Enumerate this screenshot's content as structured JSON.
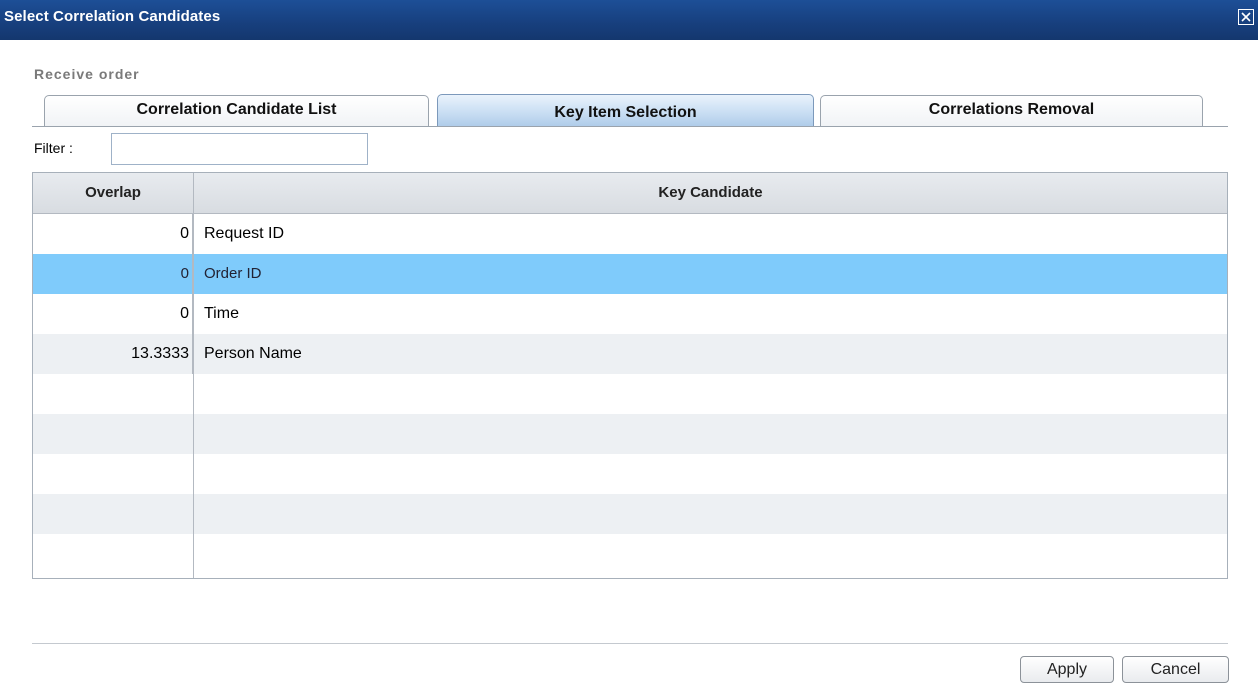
{
  "window": {
    "title": "Select Correlation Candidates"
  },
  "process_name": "Receive order",
  "tabs": [
    {
      "label": "Correlation Candidate List",
      "active": false
    },
    {
      "label": "Key Item Selection",
      "active": true
    },
    {
      "label": "Correlations Removal",
      "active": false
    }
  ],
  "filter": {
    "label": "Filter :",
    "value": "",
    "placeholder": ""
  },
  "grid": {
    "columns": {
      "overlap": "Overlap",
      "key_candidate": "Key Candidate"
    },
    "rows": [
      {
        "overlap": "0",
        "key": "Request ID",
        "selected": false
      },
      {
        "overlap": "0",
        "key": "Order ID",
        "selected": true
      },
      {
        "overlap": "0",
        "key": "Time",
        "selected": false
      },
      {
        "overlap": "13.3333",
        "key": "Person Name",
        "selected": false
      }
    ],
    "selected_color": "#7fcbfb"
  },
  "buttons": {
    "apply": "Apply",
    "cancel": "Cancel"
  },
  "colors": {
    "titlebar": "#173f7d"
  },
  "icons": {
    "close": "close-icon"
  }
}
